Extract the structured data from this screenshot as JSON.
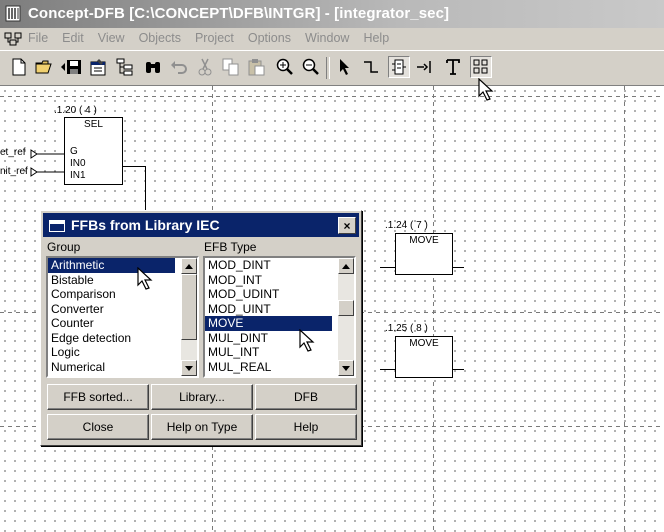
{
  "window": {
    "title": "Concept-DFB [C:\\CONCEPT\\DFB\\INTGR]  - [integrator_sec]"
  },
  "menu": [
    "File",
    "Edit",
    "View",
    "Objects",
    "Project",
    "Options",
    "Window",
    "Help"
  ],
  "toolbar": {
    "icons": [
      "new-document-icon",
      "open-folder-icon",
      "save-icon",
      "properties-icon",
      "hierarchy-icon",
      "binoculars-icon",
      "undo-icon",
      "cut-icon",
      "copy-icon",
      "paste-icon",
      "zoom-in-icon",
      "zoom-out-icon",
      "select-pointer-icon",
      "link-icon",
      "ffb-icon",
      "pin-icon",
      "text-icon",
      "ffb-library-icon"
    ]
  },
  "canvas": {
    "sel_block": {
      "number": ".1.20 ( 4 )",
      "type": "SEL",
      "pins": [
        "G",
        "IN0",
        "IN1"
      ]
    },
    "inputs": [
      "et_ref",
      "nit_ref"
    ],
    "move_block_1": {
      "number": ".1.24 ( 7 )",
      "type": "MOVE"
    },
    "move_block_2": {
      "number": ".1.25 ( 8 )",
      "type": "MOVE"
    }
  },
  "dialog": {
    "title": "FFBs from Library IEC",
    "close_symbol": "×",
    "group_label": "Group",
    "efb_label": "EFB Type",
    "groups": [
      "Arithmetic",
      "Bistable",
      "Comparison",
      "Converter",
      "Counter",
      "Edge detection",
      "Logic",
      "Numerical"
    ],
    "selected_group": "Arithmetic",
    "efb_types": [
      "MOD_DINT",
      "MOD_INT",
      "MOD_UDINT",
      "MOD_UINT",
      "MOVE",
      "MUL_DINT",
      "MUL_INT",
      "MUL_REAL"
    ],
    "selected_efb": "MOVE",
    "buttons": {
      "ffb_sorted": "FFB sorted...",
      "library": "Library...",
      "dfb": "DFB",
      "close": "Close",
      "help_on_type": "Help on Type",
      "help": "Help"
    }
  },
  "colors": {
    "title_active": "#0a246a",
    "face": "#d4d0c8",
    "selection": "#0a246a"
  }
}
